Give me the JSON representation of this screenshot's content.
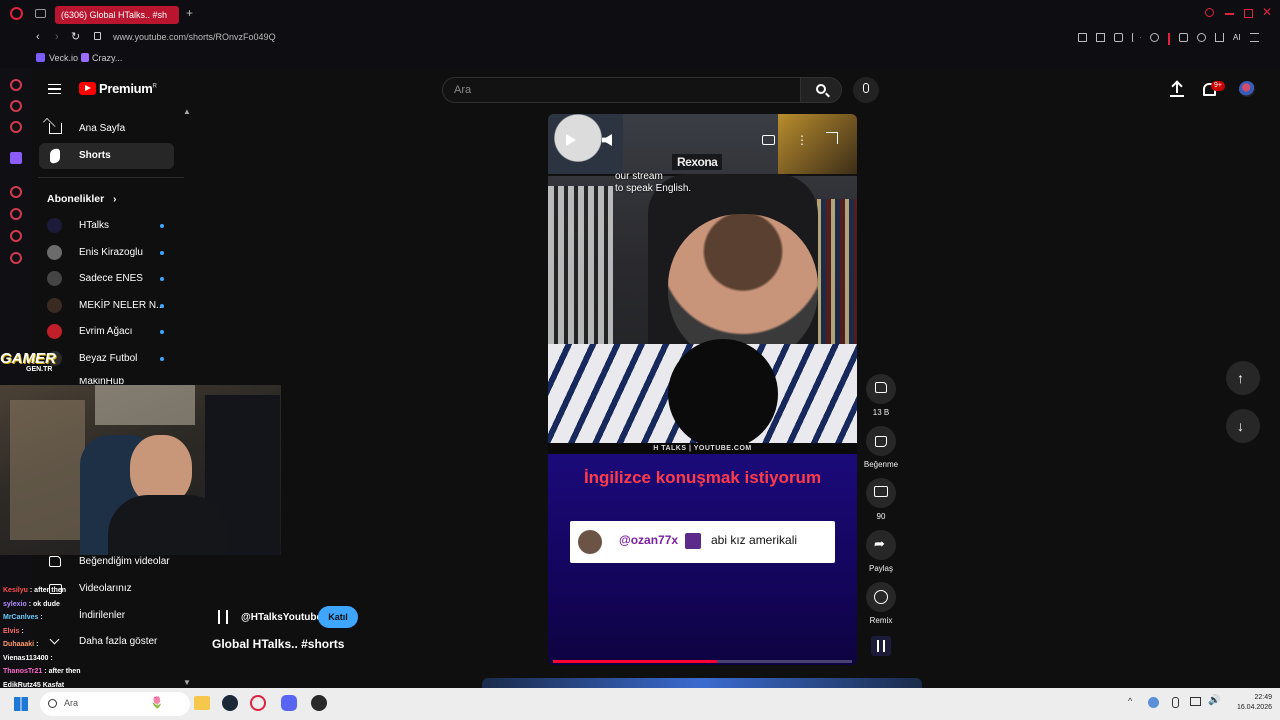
{
  "browser": {
    "tab_title": "(6306) Global HTalks.. #sh",
    "url": "www.youtube.com/shorts/ROnvzFo049Q",
    "bookmarks": [
      "Veck.io",
      "Crazy..."
    ]
  },
  "youtube": {
    "logo_text": "Premium",
    "logo_sup": "R",
    "search_placeholder": "Ara",
    "notification_count": "9+"
  },
  "sidebar": {
    "home_label": "Ana Sayfa",
    "shorts_label": "Shorts",
    "subscriptions_title": "Abonelikler",
    "subscriptions": [
      {
        "name": "HTalks",
        "color": "#1c1c3a"
      },
      {
        "name": "Enis Kirazoglu",
        "color": "#6b6b6b"
      },
      {
        "name": "Sadece ENES",
        "color": "#444444"
      },
      {
        "name": "MEKİP NELER N...",
        "color": "#3b2a22"
      },
      {
        "name": "Evrim Ağacı",
        "color": "#c01f2a"
      },
      {
        "name": "Beyaz Futbol",
        "color": "#2c2c2c"
      }
    ],
    "partial_item": "MakinHub",
    "liked_videos": "Beğendiğim videolar",
    "your_videos": "Videolarınız",
    "downloads": "İndirilenler",
    "show_more": "Daha fazla göster"
  },
  "overlay": {
    "gamer_logo": "GAMER",
    "gamer_sub": "GEN.TR"
  },
  "chat": [
    {
      "user": "Kesilyu",
      "text": ": after then",
      "color": "#ff4d4d"
    },
    {
      "user": "sylexio",
      "text": ": ok dude",
      "color": "#b18cff"
    },
    {
      "user": "MrCanlves",
      "text": ":",
      "color": "#66ccff"
    },
    {
      "user": "Elvis",
      "text": ":",
      "color": "#ff6a6a"
    },
    {
      "user": "Duhaaaki",
      "text": ":",
      "color": "#ff9966"
    },
    {
      "user": "Vienas113400",
      "text": ":",
      "color": "#ffffff"
    },
    {
      "user": "ThanosTr21",
      "text": ": after then",
      "color": "#ff66cc"
    },
    {
      "user": "EdikRutz45",
      "text": "Kasfat",
      "color": "#ffffff"
    }
  ],
  "short": {
    "top_caption_1": "our stream",
    "top_caption_2": "to speak English.",
    "brand_sign": "Rexona",
    "watermark": "H TALKS | YOUTUBE.COM",
    "headline": "İngilizce konuşmak istiyorum",
    "comment_user": "@ozan77x",
    "comment_text": "abi kız amerikali",
    "progress": 0.55,
    "channel_handle": "@HTalksYoutube",
    "join_label": "Katıl",
    "title": "Global HTalks.. #shorts"
  },
  "actions": {
    "like_count": "13 B",
    "dislike_label": "Beğenme",
    "comment_count": "90",
    "share_label": "Paylaş",
    "remix_label": "Remix"
  },
  "taskbar": {
    "search_placeholder": "Ara",
    "time": "22:49",
    "date": "16.04.2026"
  }
}
